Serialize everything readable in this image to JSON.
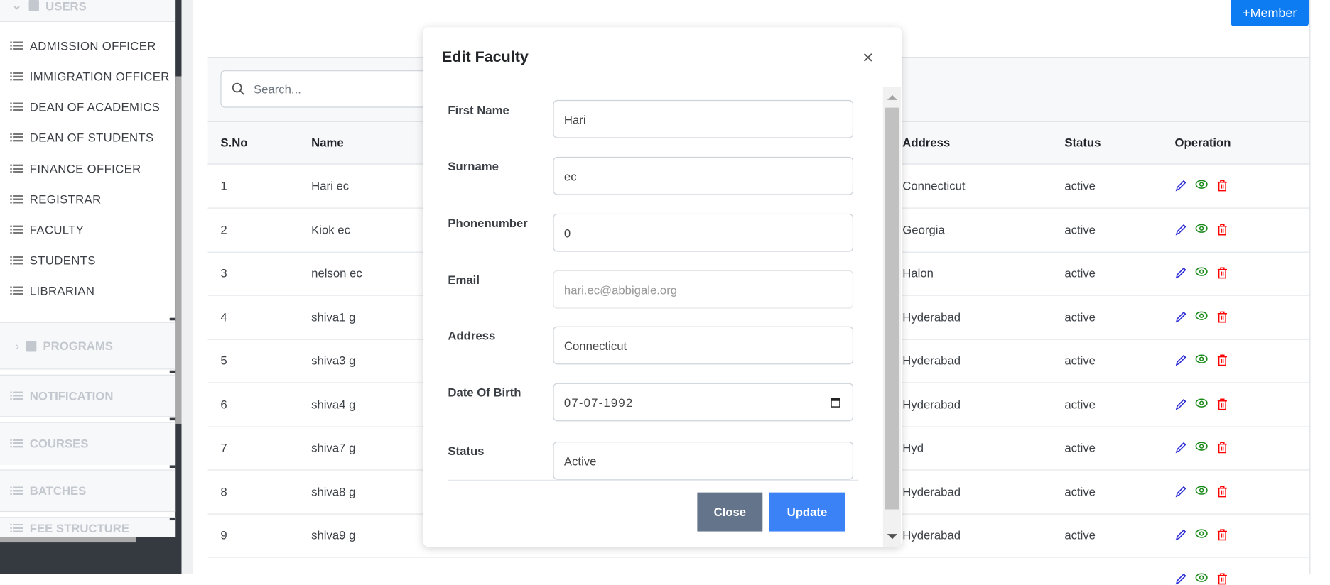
{
  "sidebar": {
    "users_header": "USERS",
    "items": [
      {
        "label": "ADMISSION OFFICER"
      },
      {
        "label": "IMMIGRATION OFFICER"
      },
      {
        "label": "DEAN OF ACADEMICS"
      },
      {
        "label": "DEAN OF STUDENTS"
      },
      {
        "label": "FINANCE OFFICER"
      },
      {
        "label": "REGISTRAR"
      },
      {
        "label": "FACULTY"
      },
      {
        "label": "STUDENTS"
      },
      {
        "label": "LIBRARIAN"
      }
    ],
    "sections": {
      "programs": "PROGRAMS",
      "notification": "NOTIFICATION",
      "courses": "COURSES",
      "batches": "BATCHES",
      "fee_structure": "FEE STRUCTURE"
    }
  },
  "header": {
    "member_button": "+Member"
  },
  "search": {
    "placeholder": "Search..."
  },
  "table": {
    "columns": {
      "sno": "S.No",
      "name": "Name",
      "address": "Address",
      "status": "Status",
      "operation": "Operation"
    },
    "rows": [
      {
        "sno": "1",
        "name": "Hari ec",
        "address": "Connecticut",
        "status": "active"
      },
      {
        "sno": "2",
        "name": "Kiok ec",
        "address": "Georgia",
        "status": "active"
      },
      {
        "sno": "3",
        "name": "nelson ec",
        "address": "Halon",
        "status": "active"
      },
      {
        "sno": "4",
        "name": "shiva1 g",
        "address": "Hyderabad",
        "status": "active"
      },
      {
        "sno": "5",
        "name": "shiva3 g",
        "address": "Hyderabad",
        "status": "active"
      },
      {
        "sno": "6",
        "name": "shiva4 g",
        "address": "Hyderabad",
        "status": "active"
      },
      {
        "sno": "7",
        "name": "shiva7 g",
        "address": "Hyd",
        "status": "active"
      },
      {
        "sno": "8",
        "name": "shiva8 g",
        "address": "Hyderabad",
        "status": "active"
      },
      {
        "sno": "9",
        "name": "shiva9 g",
        "address": "Hyderabad",
        "status": "active"
      }
    ]
  },
  "modal": {
    "title": "Edit Faculty",
    "close_icon": "×",
    "fields": {
      "first_name": {
        "label": "First Name",
        "value": "Hari"
      },
      "surname": {
        "label": "Surname",
        "value": "ec"
      },
      "phone": {
        "label": "Phonenumber",
        "value": "0"
      },
      "email": {
        "label": "Email",
        "value": "hari.ec@abbigale.org"
      },
      "address": {
        "label": "Address",
        "value": "Connecticut"
      },
      "dob": {
        "label": "Date Of Birth",
        "value": "07-07-1992"
      },
      "status": {
        "label": "Status",
        "value": "Active"
      }
    },
    "close_button": "Close",
    "update_button": "Update"
  },
  "colors": {
    "primary": "#0d7cf2",
    "update": "#3b82f6",
    "close": "#64748b",
    "edit": "#2b2bd6",
    "view": "#1a8a1a",
    "delete": "#ff0000"
  }
}
